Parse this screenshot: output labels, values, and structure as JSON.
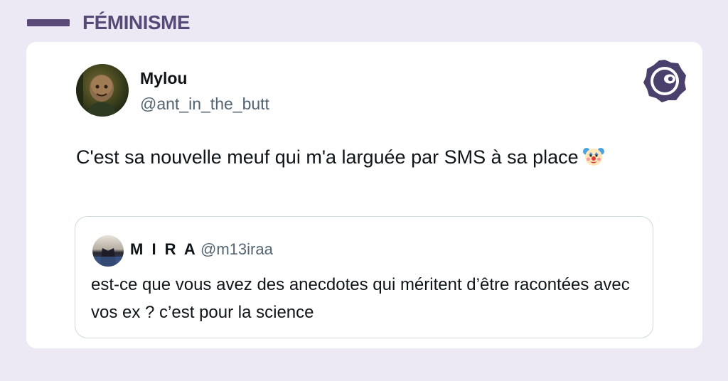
{
  "category": {
    "label": "FÉMINISME"
  },
  "tweet": {
    "author_name": "Mylou",
    "author_handle": "@ant_in_the_butt",
    "text": "C'est sa nouvelle meuf qui m'a larguée par SMS à sa place",
    "emoji_icon": "clown-face-icon"
  },
  "quoted_tweet": {
    "author_name": "M I R A",
    "author_handle": "@m13iraa",
    "text": "est-ce que vous avez des anecdotes qui méritent d’être racontées avec vos ex ? c’est pour la science"
  },
  "brand": {
    "icon": "brand-logo-icon",
    "color": "#4b3f6b"
  },
  "colors": {
    "page_background": "#ece9f4",
    "card_background": "#ffffff",
    "accent": "#564b78"
  }
}
